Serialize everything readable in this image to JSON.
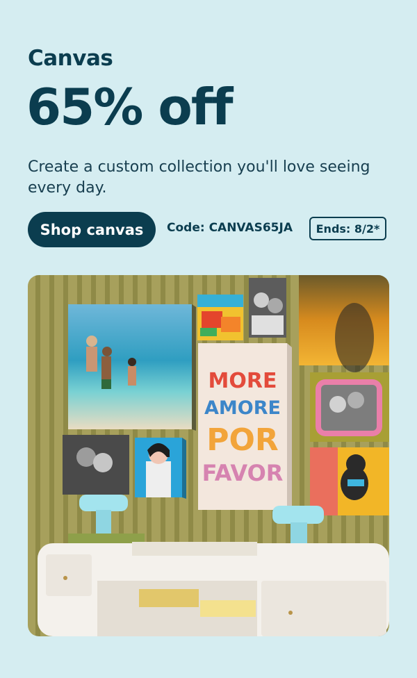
{
  "promo": {
    "eyebrow": "Canvas",
    "headline": "65% off",
    "description": "Create a custom collection you'll love seeing every day.",
    "cta_label": "Shop canvas",
    "code_text": "Code:  CANVAS65JA",
    "ends_text": "Ends:  8/2*"
  },
  "art_print": {
    "lines": [
      "MORE",
      "AMORE",
      "POR",
      "FAVOR"
    ]
  },
  "colors": {
    "background": "#d5edf1",
    "brand_navy": "#0b3d4f",
    "wall_olive": "#a49a58",
    "console_white": "#f4f1ec",
    "lamp_aqua": "#9ee0ea"
  }
}
